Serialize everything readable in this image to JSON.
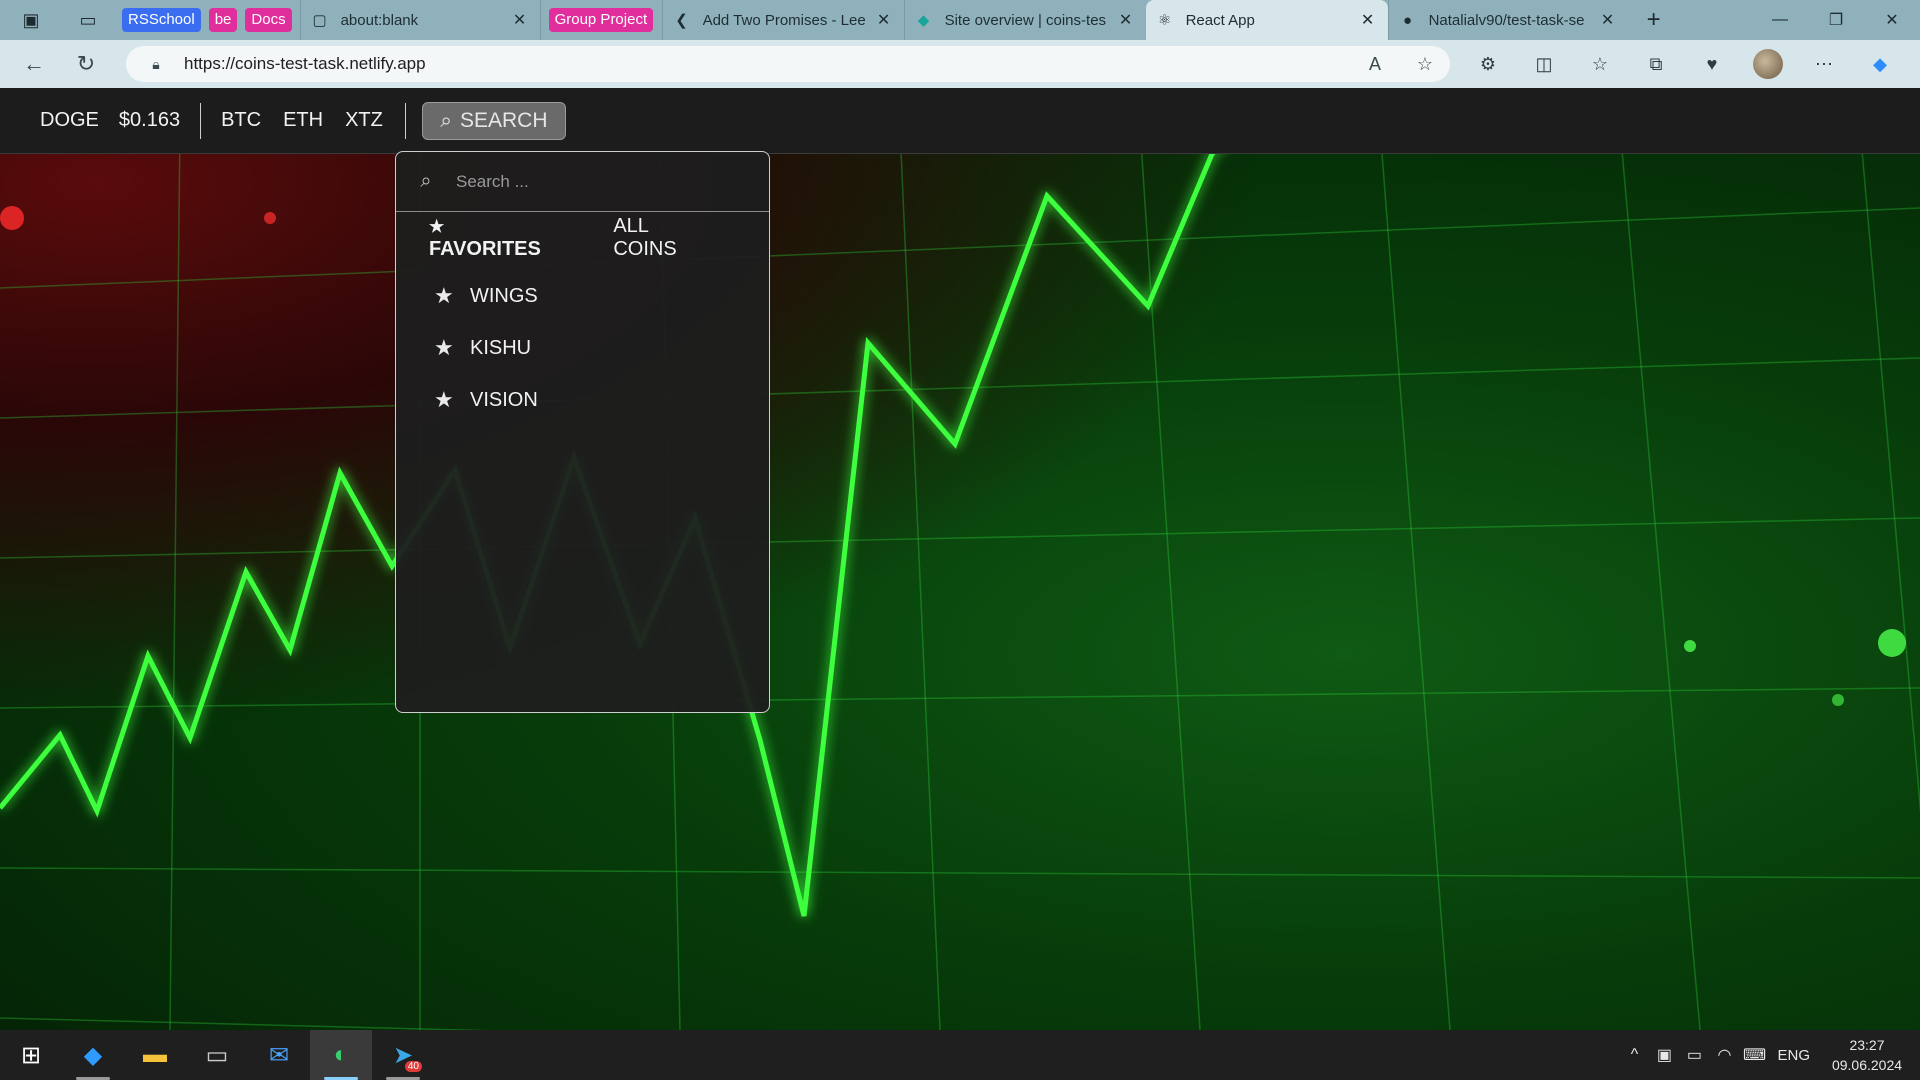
{
  "browser": {
    "bookmarks": [
      {
        "label": "RSSchool",
        "color": "#3a6df0"
      },
      {
        "label": "be",
        "color": "#e02f9c"
      },
      {
        "label": "Docs",
        "color": "#e02f9c"
      }
    ],
    "tabs": [
      {
        "title": "about:blank",
        "icon": "page-icon"
      },
      {
        "title": "Group Project",
        "icon": "none",
        "chip_color": "#e02f9c"
      },
      {
        "title": "Add Two Promises - Lee",
        "icon": "leetcode-icon"
      },
      {
        "title": "Site overview | coins-tes",
        "icon": "netlify-icon"
      },
      {
        "title": "React App",
        "icon": "react-icon",
        "active": true
      },
      {
        "title": "Natalialv90/test-task-se",
        "icon": "github-icon"
      }
    ],
    "url": "https://coins-test-task.netlify.app"
  },
  "app": {
    "header": {
      "current_coin": "DOGE",
      "current_price": "$0.163",
      "coins": [
        "BTC",
        "ETH",
        "XTZ"
      ],
      "search_label": "SEARCH"
    },
    "dropdown": {
      "search_placeholder": "Search ...",
      "tabs": [
        "FAVORITES",
        "ALL COINS"
      ],
      "favorites_star": "★",
      "items": [
        "WINGS",
        "KISHU",
        "VISION"
      ]
    }
  },
  "taskbar": {
    "apps": [
      "windows-start-icon",
      "vscode-icon",
      "file-explorer-icon",
      "terminal-icon",
      "mail-icon",
      "edge-icon",
      "telegram-icon"
    ],
    "telegram_badge": "40",
    "language": "ENG",
    "time": "23:27",
    "date": "09.06.2024"
  },
  "colors": {
    "accent_green": "#39ff3f",
    "header_bg": "#1c1c1c",
    "tabbar_bg": "#8fb1bb"
  }
}
